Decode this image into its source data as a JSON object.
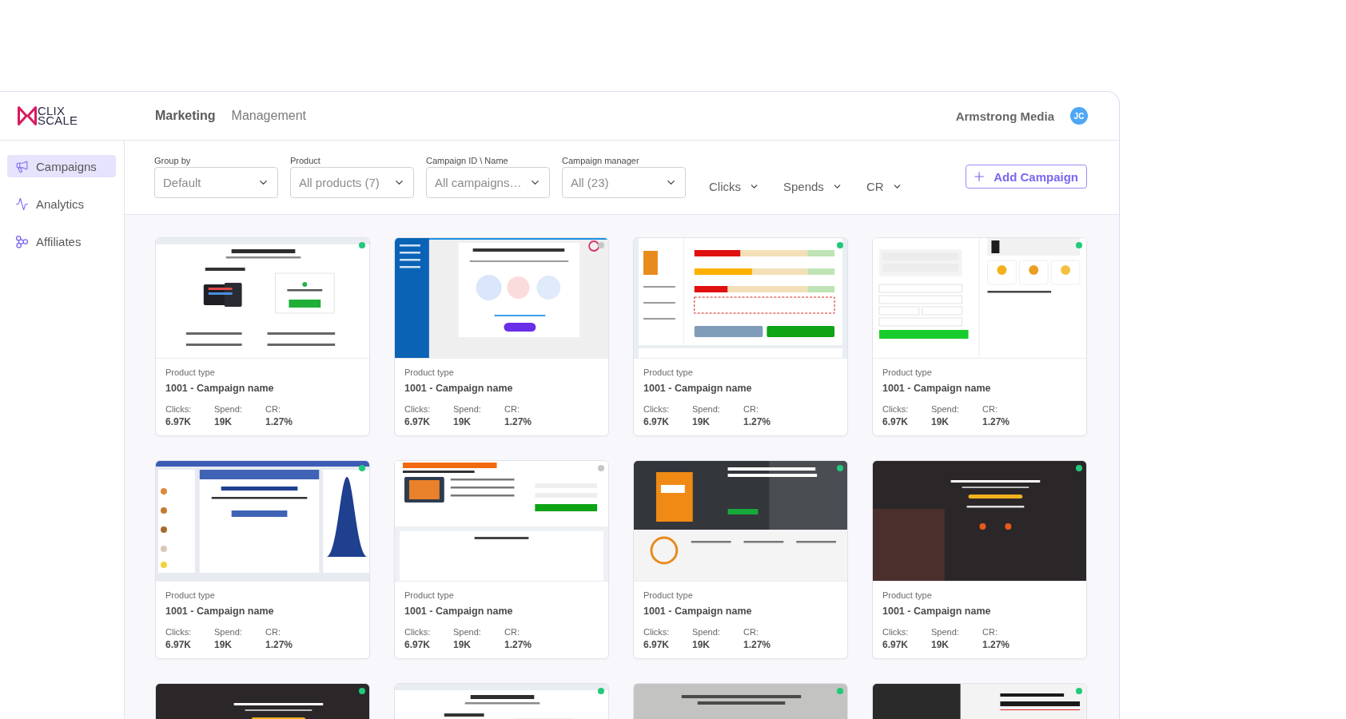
{
  "logo": {
    "lines": [
      "CLIX",
      "SCALE"
    ]
  },
  "nav_tabs": [
    {
      "label": "Marketing",
      "selected": true
    },
    {
      "label": "Management",
      "selected": false
    }
  ],
  "account": {
    "name": "Armstrong Media",
    "initials": "JC"
  },
  "sidebar": {
    "items": [
      {
        "label": "Campaigns",
        "selected": true
      },
      {
        "label": "Analytics",
        "selected": false
      },
      {
        "label": "Affiliates",
        "selected": false
      }
    ]
  },
  "filters": [
    {
      "label": "Group by",
      "value": "Default"
    },
    {
      "label": "Product",
      "value": "All products (7)"
    },
    {
      "label": "Campaign ID \\ Name",
      "value": "All campaigns…"
    },
    {
      "label": "Campaign manager",
      "value": "All (23)"
    }
  ],
  "sort_menus": [
    "Clicks",
    "Spends",
    "CR"
  ],
  "add_button": "Add Campaign",
  "cards": [
    {
      "kind": "download",
      "color": "#21c97b",
      "product_type": "Product type",
      "name": "1001 - Campaign name",
      "stats": [
        {
          "label": "Clicks:",
          "value": "6.97K"
        },
        {
          "label": "Spend:",
          "value": "19K"
        },
        {
          "label": "CR:",
          "value": "1.27%"
        }
      ]
    },
    {
      "kind": "sidebar",
      "color": "#c6c6c6",
      "product_type": "Product type",
      "name": "1001 - Campaign name",
      "stats": [
        {
          "label": "Clicks:",
          "value": "6.97K"
        },
        {
          "label": "Spend:",
          "value": "19K"
        },
        {
          "label": "CR:",
          "value": "1.27%"
        }
      ]
    },
    {
      "kind": "scan",
      "color": "#21c97b",
      "product_type": "Product type",
      "name": "1001 - Campaign name",
      "stats": [
        {
          "label": "Clicks:",
          "value": "6.97K"
        },
        {
          "label": "Spend:",
          "value": "19K"
        },
        {
          "label": "CR:",
          "value": "1.27%"
        }
      ]
    },
    {
      "kind": "form",
      "color": "#21c97b",
      "product_type": "Product type",
      "name": "1001 - Campaign name",
      "stats": [
        {
          "label": "Clicks:",
          "value": "6.97K"
        },
        {
          "label": "Spend:",
          "value": "19K"
        },
        {
          "label": "CR:",
          "value": "1.27%"
        }
      ]
    },
    {
      "kind": "quiz",
      "color": "#21c97b",
      "product_type": "Product type",
      "name": "1001 - Campaign name",
      "stats": [
        {
          "label": "Clicks:",
          "value": "6.97K"
        },
        {
          "label": "Spend:",
          "value": "19K"
        },
        {
          "label": "CR:",
          "value": "1.27%"
        }
      ]
    },
    {
      "kind": "promo",
      "color": "#c6c6c6",
      "product_type": "Product type",
      "name": "1001 - Campaign name",
      "stats": [
        {
          "label": "Clicks:",
          "value": "6.97K"
        },
        {
          "label": "Spend:",
          "value": "19K"
        },
        {
          "label": "CR:",
          "value": "1.27%"
        }
      ]
    },
    {
      "kind": "boxshot",
      "color": "#21c97b",
      "product_type": "Product type",
      "name": "1001 - Campaign name",
      "stats": [
        {
          "label": "Clicks:",
          "value": "6.97K"
        },
        {
          "label": "Spend:",
          "value": "19K"
        },
        {
          "label": "CR:",
          "value": "1.27%"
        }
      ]
    },
    {
      "kind": "dark",
      "color": "#21c97b",
      "product_type": "Product type",
      "name": "1001 - Campaign name",
      "stats": [
        {
          "label": "Clicks:",
          "value": "6.97K"
        },
        {
          "label": "Spend:",
          "value": "19K"
        },
        {
          "label": "CR:",
          "value": "1.27%"
        }
      ]
    },
    {
      "kind": "dark",
      "color": "#21c97b"
    },
    {
      "kind": "download",
      "color": "#21c97b"
    },
    {
      "kind": "photo",
      "color": "#21c97b"
    },
    {
      "kind": "split",
      "color": "#21c97b"
    }
  ]
}
